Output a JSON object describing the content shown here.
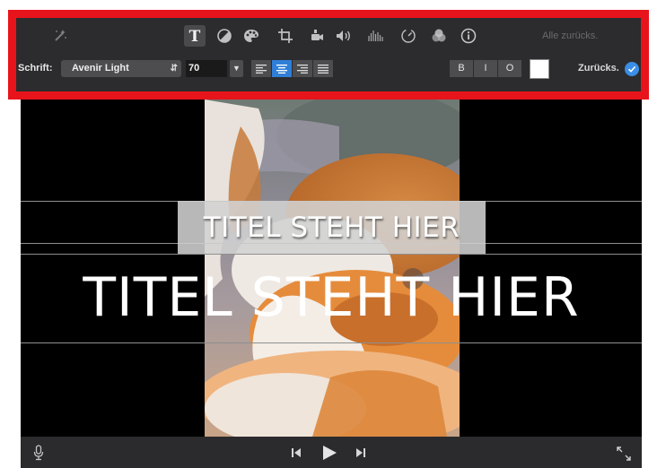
{
  "toolbar": {
    "icons": [
      {
        "name": "magic-wand-icon"
      },
      {
        "name": "text-icon",
        "active": true
      },
      {
        "name": "color-balance-icon"
      },
      {
        "name": "color-palette-icon"
      },
      {
        "name": "crop-icon"
      },
      {
        "name": "stabilization-camera-icon"
      },
      {
        "name": "volume-icon"
      },
      {
        "name": "equalizer-icon"
      },
      {
        "name": "speed-icon"
      },
      {
        "name": "filter-icon"
      },
      {
        "name": "info-icon"
      }
    ],
    "reset_all_label": "Alle zurücks."
  },
  "text_settings": {
    "font_label": "Schrift:",
    "font_value": "Avenir Light",
    "size_value": "70",
    "alignment_options": [
      "left",
      "center",
      "right",
      "justify"
    ],
    "alignment_selected": "center",
    "style_buttons": [
      "B",
      "I",
      "O"
    ],
    "text_color": "#ffffff",
    "reset_label": "Zurücks.",
    "accent_color": "#2f7fd8"
  },
  "viewer": {
    "title_small": "TITEL STEHT HIER",
    "title_large": "TITEL STEHT HIER"
  },
  "playback": {
    "icons": [
      "microphone-icon",
      "skip-back-icon",
      "play-icon",
      "skip-forward-icon",
      "fullscreen-icon"
    ]
  },
  "highlight_color": "#e8141b"
}
